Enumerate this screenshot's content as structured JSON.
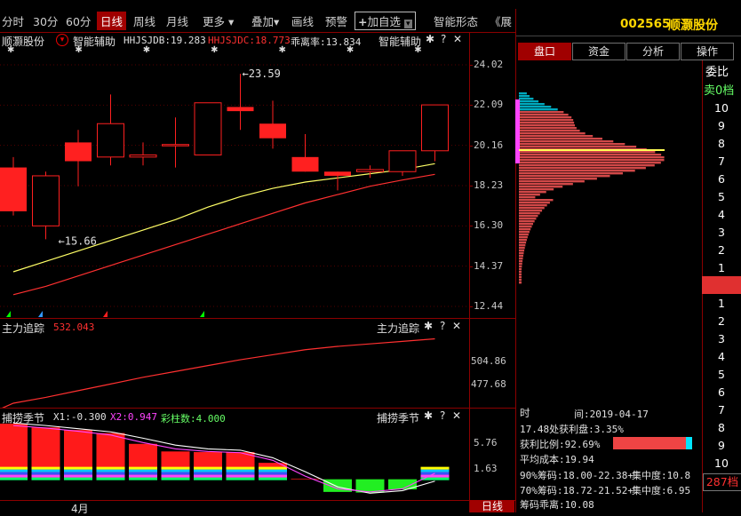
{
  "toolbar": {
    "items": [
      "分时",
      "30分",
      "60分",
      "日线",
      "周线",
      "月线",
      "更多 ▾",
      "叠加▾",
      "画线",
      "预警",
      "加自选",
      "智能形态",
      "《展"
    ],
    "active_index": 3,
    "add_watch_plus": "+"
  },
  "stock": {
    "code": "002565",
    "name": "顺灏股份"
  },
  "main_chart": {
    "name": "顺灏股份",
    "indicator": "智能辅助",
    "hhjsjdb_label": "HHJSJDB:19.283",
    "hhjsjdc_label": "HHJSJDC:18.773",
    "deviation_label": "乖离率:13.834",
    "right_label": "智能辅助",
    "high_marker": "23.59",
    "low_marker": "15.66",
    "y_ticks": [
      "24.02",
      "22.09",
      "20.16",
      "18.23",
      "16.30",
      "14.37",
      "12.44"
    ],
    "colors": {
      "up": "#ff2020",
      "down": "#00ffff",
      "yellow_ma": "#ffff66",
      "red_ma": "#ff3030"
    }
  },
  "sub_chart1": {
    "name": "主力追踪",
    "value": "532.043",
    "right_label": "主力追踪",
    "y_ticks": [
      "504.86",
      "477.68"
    ]
  },
  "sub_chart2": {
    "name": "捕捞季节",
    "x1_label": "X1:-0.300",
    "x2_label": "X2:0.947",
    "bars_label": "彩柱数:4.000",
    "right_label": "捕捞季节",
    "y_ticks": [
      "5.76",
      "1.63"
    ]
  },
  "footer": {
    "month": "4月",
    "period": "日线"
  },
  "panel": {
    "tabs": [
      "盘口",
      "资金",
      "分析",
      "操作"
    ],
    "active_tab": 0,
    "committee": "委比",
    "sell_zero": "卖0档",
    "upper_levels": [
      "10",
      "9",
      "8",
      "7",
      "6",
      "5",
      "4",
      "3",
      "2",
      "1"
    ],
    "lower_levels": [
      "1",
      "2",
      "3",
      "4",
      "5",
      "6",
      "7",
      "8",
      "9",
      "10"
    ],
    "buy_levels": "287档",
    "info": {
      "time_label": "时",
      "time_value": "间:2019-04-17",
      "profit_line": "17.48处获利盘:3.35%",
      "profit_ratio_label": "获利比例:92.69%",
      "avg_cost": "平均成本:19.94",
      "chip90": "90%筹码:18.00-22.38+",
      "conc90": "集中度:10.8",
      "chip70": "70%筹码:18.72-21.52+",
      "conc70": "集中度:6.95",
      "chip_dev": "筹码乖离:10.08"
    }
  },
  "chart_data": [
    {
      "type": "candlestick",
      "title": "",
      "ylim": [
        12.44,
        24.02
      ],
      "candles": [
        {
          "open": 19.1,
          "close": 17.0,
          "high": 19.6,
          "low": 16.8
        },
        {
          "open": 16.3,
          "close": 18.7,
          "high": 18.9,
          "low": 15.66
        },
        {
          "open": 20.3,
          "close": 19.4,
          "high": 20.9,
          "low": 18.2
        },
        {
          "open": 19.6,
          "close": 21.2,
          "high": 22.6,
          "low": 19.2
        },
        {
          "open": 19.6,
          "close": 19.7,
          "high": 20.3,
          "low": 19.2
        },
        {
          "open": 20.2,
          "close": 20.2,
          "high": 21.5,
          "low": 19.1
        },
        {
          "open": 19.7,
          "close": 22.2,
          "high": 22.2,
          "low": 19.7
        },
        {
          "open": 22.0,
          "close": 21.8,
          "high": 23.59,
          "low": 20.9
        },
        {
          "open": 21.2,
          "close": 20.5,
          "high": 22.3,
          "low": 20.0
        },
        {
          "open": 19.6,
          "close": 18.9,
          "high": 20.7,
          "low": 18.9
        },
        {
          "open": 18.9,
          "close": 18.7,
          "high": 18.9,
          "low": 18.0
        },
        {
          "open": 18.9,
          "close": 19.0,
          "high": 19.2,
          "low": 18.6
        },
        {
          "open": 18.9,
          "close": 19.9,
          "high": 19.9,
          "low": 18.7
        },
        {
          "open": 19.9,
          "close": 22.1,
          "high": 22.1,
          "low": 19.4
        }
      ],
      "series": [
        {
          "name": "HHJSJDB",
          "color": "#ffff66",
          "values": [
            14.1,
            14.6,
            15.1,
            15.6,
            16.1,
            16.6,
            17.2,
            17.7,
            18.1,
            18.4,
            18.6,
            18.8,
            19.0,
            19.28
          ]
        },
        {
          "name": "HHJSJDC",
          "color": "#ff3030",
          "values": [
            13.0,
            13.4,
            13.9,
            14.4,
            14.9,
            15.4,
            15.9,
            16.4,
            16.9,
            17.4,
            17.8,
            18.2,
            18.5,
            18.77
          ]
        }
      ]
    },
    {
      "type": "line",
      "title": "",
      "series": [
        {
          "name": "主力追踪",
          "values": [
            455,
            462,
            470,
            478,
            486,
            493,
            500,
            507,
            513,
            519,
            523,
            526,
            529,
            532.043
          ]
        }
      ],
      "ylim": [
        455,
        540
      ]
    },
    {
      "type": "bar",
      "title": "",
      "ylim": [
        -3,
        9.5
      ],
      "bar_values": [
        8.8,
        8.2,
        7.8,
        7.3,
        5.6,
        4.4,
        4.3,
        4.3,
        2.6,
        0.1,
        -2.0,
        -2.1,
        -1.6,
        1.63
      ],
      "series": [
        {
          "name": "X1",
          "color": "#ffffff",
          "values": [
            8.9,
            8.5,
            8.0,
            7.5,
            6.5,
            5.4,
            4.8,
            4.6,
            3.4,
            1.2,
            -1.2,
            -2.2,
            -1.8,
            -0.3
          ]
        },
        {
          "name": "X2",
          "color": "#ff44ff",
          "values": [
            8.5,
            8.1,
            7.6,
            7.0,
            5.8,
            4.8,
            4.4,
            4.2,
            3.0,
            0.5,
            -1.5,
            -2.0,
            -1.5,
            0.947
          ]
        }
      ]
    }
  ]
}
